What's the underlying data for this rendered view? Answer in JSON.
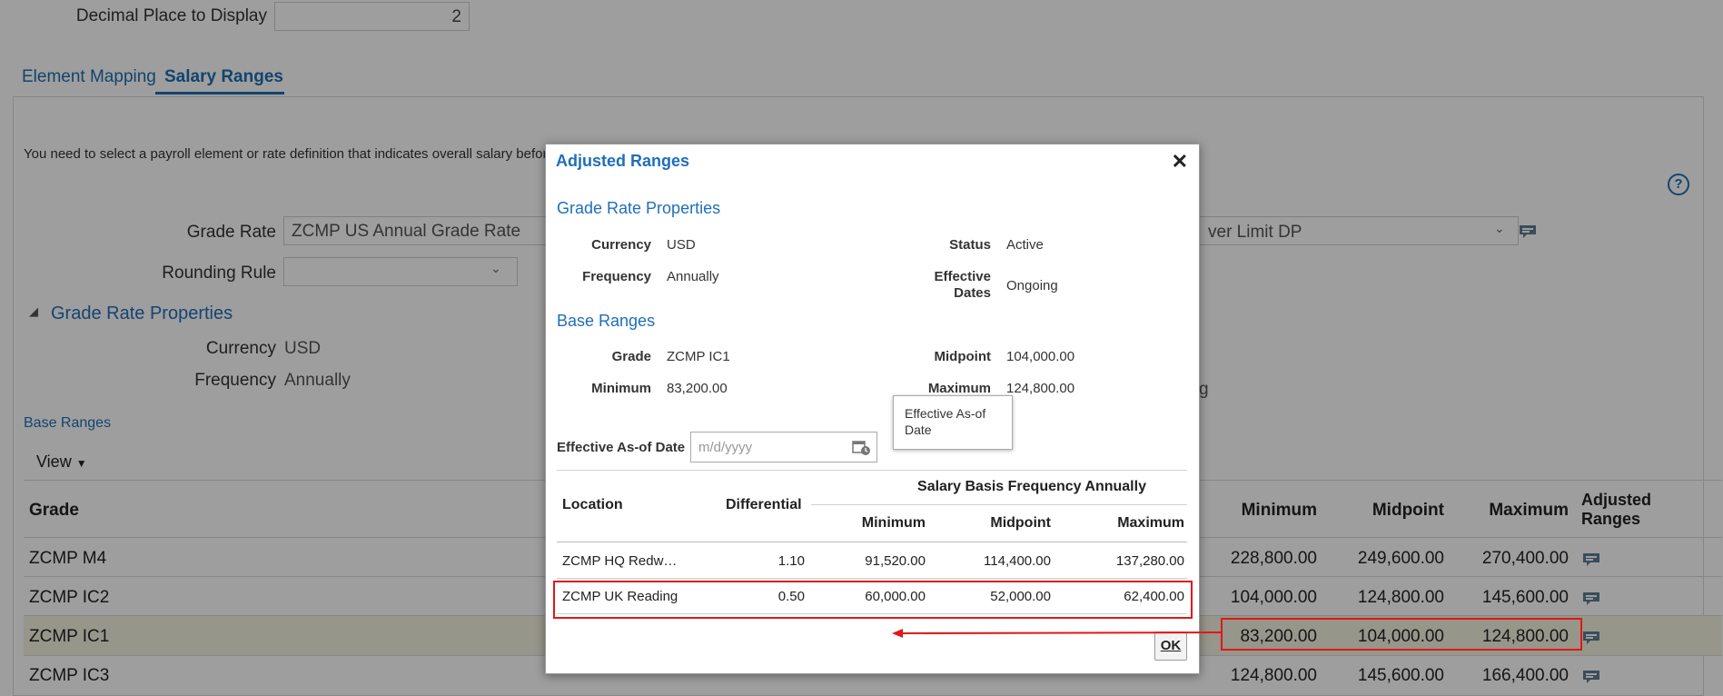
{
  "top": {
    "decimal_label": "Decimal Place to Display",
    "decimal_value": "2"
  },
  "tabs": [
    {
      "label": "Element Mapping"
    },
    {
      "label": "Salary Ranges"
    }
  ],
  "info_text": "You need to select a payroll element or rate definition that indicates overall salary before y",
  "grade_rate": {
    "label": "Grade Rate",
    "value": "ZCMP US Annual Grade Rate",
    "right_value": "ver Limit DP"
  },
  "rounding_rule": {
    "label": "Rounding Rule",
    "value": ""
  },
  "grp": {
    "title": "Grade Rate Properties",
    "currency_label": "Currency",
    "currency_value": "USD",
    "frequency_label": "Frequency",
    "frequency_value": "Annually",
    "partial_right": "g"
  },
  "base_ranges_link": "Base Ranges",
  "view_menu": "View",
  "table": {
    "headers": {
      "grade": "Grade",
      "minimum": "Minimum",
      "midpoint": "Midpoint",
      "maximum": "Maximum",
      "adjusted_line1": "Adjusted",
      "adjusted_line2": "Ranges"
    },
    "rows": [
      {
        "grade": "ZCMP M4",
        "minimum": "228,800.00",
        "midpoint": "249,600.00",
        "maximum": "270,400.00"
      },
      {
        "grade": "ZCMP IC2",
        "minimum": "104,000.00",
        "midpoint": "124,800.00",
        "maximum": "145,600.00"
      },
      {
        "grade": "ZCMP IC1",
        "minimum": "83,200.00",
        "midpoint": "104,000.00",
        "maximum": "124,800.00"
      },
      {
        "grade": "ZCMP IC3",
        "minimum": "124,800.00",
        "midpoint": "145,600.00",
        "maximum": "166,400.00"
      }
    ]
  },
  "modal": {
    "title": "Adjusted Ranges",
    "close_glyph": "✕",
    "grp_title": "Grade Rate Properties",
    "currency_label": "Currency",
    "currency_value": "USD",
    "frequency_label": "Frequency",
    "frequency_value": "Annually",
    "status_label": "Status",
    "status_value": "Active",
    "effective_dates_label1": "Effective",
    "effective_dates_label2": "Dates",
    "effective_dates_value": "Ongoing",
    "base_title": "Base Ranges",
    "grade_label": "Grade",
    "grade_value": "ZCMP IC1",
    "minimum_label": "Minimum",
    "minimum_value": "83,200.00",
    "midpoint_label": "Midpoint",
    "midpoint_value": "104,000.00",
    "maximum_label": "Maximum",
    "maximum_value": "124,800.00",
    "eff_asof_label": "Effective As-of Date",
    "eff_asof_placeholder": "m/d/yyyy",
    "tooltip_line1": "Effective As-of",
    "tooltip_line2": "Date",
    "table": {
      "location": "Location",
      "differential": "Differential",
      "group": "Salary Basis Frequency Annually",
      "minimum": "Minimum",
      "midpoint": "Midpoint",
      "maximum": "Maximum",
      "rows": [
        {
          "location": "ZCMP HQ Redw…",
          "differential": "1.10",
          "minimum": "91,520.00",
          "midpoint": "114,400.00",
          "maximum": "137,280.00"
        },
        {
          "location": "ZCMP UK Reading",
          "differential": "0.50",
          "minimum": "60,000.00",
          "midpoint": "52,000.00",
          "maximum": "62,400.00"
        }
      ]
    },
    "ok_label": "OK"
  },
  "colors": {
    "accent": "#1f6fb8",
    "highlight_red": "#e01818",
    "selected_row": "#f4f2df"
  }
}
